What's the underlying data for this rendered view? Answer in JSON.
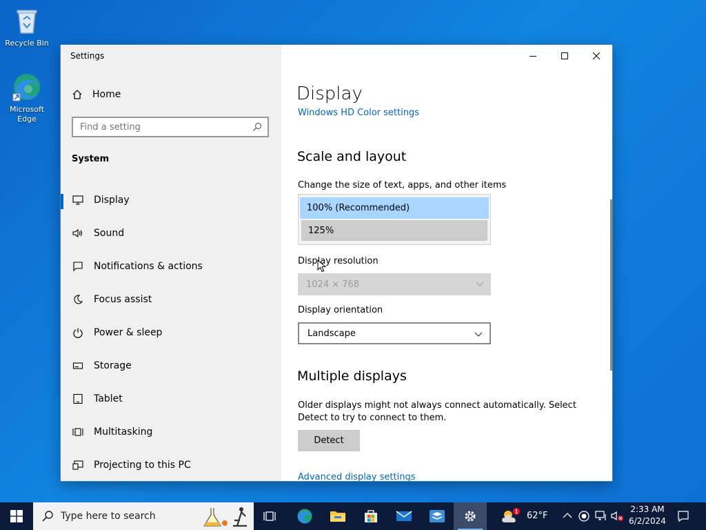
{
  "desktop": {
    "icons": [
      {
        "label": "Recycle Bin"
      },
      {
        "label": "Microsoft Edge"
      }
    ]
  },
  "window": {
    "title": "Settings",
    "controls": {
      "minimize": "minimize-icon",
      "maximize": "maximize-icon",
      "close": "close-icon"
    }
  },
  "sidebar": {
    "home_label": "Home",
    "search_placeholder": "Find a setting",
    "section_title": "System",
    "items": [
      {
        "label": "Display",
        "icon": "monitor-icon",
        "active": true
      },
      {
        "label": "Sound",
        "icon": "speaker-icon"
      },
      {
        "label": "Notifications & actions",
        "icon": "notification-icon"
      },
      {
        "label": "Focus assist",
        "icon": "moon-icon"
      },
      {
        "label": "Power & sleep",
        "icon": "power-icon"
      },
      {
        "label": "Storage",
        "icon": "storage-icon"
      },
      {
        "label": "Tablet",
        "icon": "tablet-icon"
      },
      {
        "label": "Multitasking",
        "icon": "multitasking-icon"
      },
      {
        "label": "Projecting to this PC",
        "icon": "projecting-icon"
      }
    ]
  },
  "content": {
    "page_title": "Display",
    "hd_color_link": "Windows HD Color settings",
    "scale_heading": "Scale and layout",
    "scale_label": "Change the size of text, apps, and other items",
    "scale_options": [
      "100% (Recommended)",
      "125%"
    ],
    "resolution_label": "Display resolution",
    "resolution_value": "1024 × 768",
    "orientation_label": "Display orientation",
    "orientation_value": "Landscape",
    "multi_heading": "Multiple displays",
    "multi_text": "Older displays might not always connect automatically. Select Detect to try to connect to them.",
    "detect_button": "Detect",
    "advanced_link": "Advanced display settings"
  },
  "taskbar": {
    "search_placeholder": "Type here to search",
    "weather_temp": "62°F",
    "weather_badge": "1",
    "time": "2:33 AM",
    "date": "6/2/2024"
  },
  "colors": {
    "accent": "#0067c0",
    "selected_option": "#a8d6ff",
    "taskbar": "#0c1b3a"
  }
}
